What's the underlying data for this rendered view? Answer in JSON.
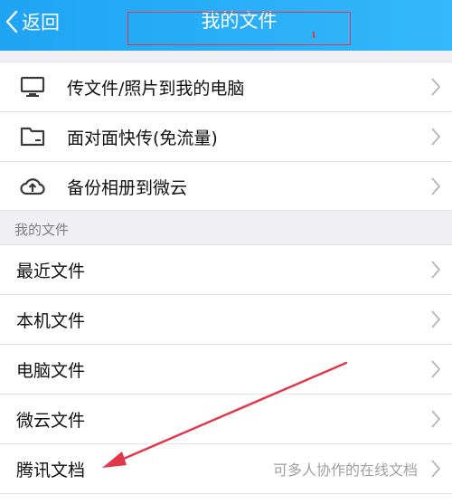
{
  "header": {
    "back_label": "返回",
    "title": "我的文件"
  },
  "top_group": [
    {
      "label": "传文件/照片到我的电脑",
      "icon": "monitor-icon"
    },
    {
      "label": "面对面快传(免流量)",
      "icon": "folder-icon"
    },
    {
      "label": "备份相册到微云",
      "icon": "cloud-upload-icon"
    }
  ],
  "files_section": {
    "header": "我的文件",
    "items": [
      {
        "label": "最近文件"
      },
      {
        "label": "本机文件"
      },
      {
        "label": "电脑文件"
      },
      {
        "label": "微云文件"
      },
      {
        "label": "腾讯文档",
        "hint": "可多人协作的在线文档"
      }
    ]
  },
  "colors": {
    "header_gradient": [
      "#1fa4f4",
      "#33b8fb"
    ],
    "annotation": "#e2364a"
  }
}
